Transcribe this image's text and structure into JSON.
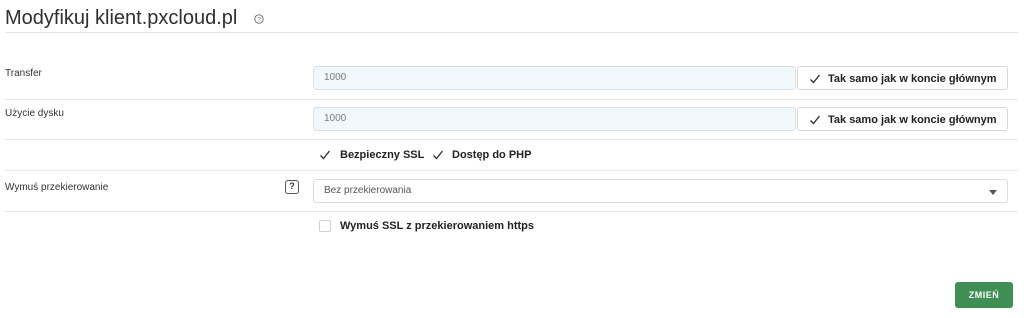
{
  "header": {
    "title": "Modyfikuj klient.pxcloud.pl",
    "help_icon": "question-circle-icon"
  },
  "transfer": {
    "label": "Transfer",
    "value": "1000",
    "same_label": "Tak samo jak w koncie głównym",
    "same_checked": true
  },
  "disk": {
    "label": "Użycie dysku",
    "value": "1000",
    "same_label": "Tak samo jak w koncie głównym",
    "same_checked": true
  },
  "options": [
    {
      "label": "Bezpieczny SSL",
      "checked": true
    },
    {
      "label": "Dostęp do PHP",
      "checked": true
    }
  ],
  "redirect": {
    "label": "Wymuś przekierowanie",
    "help_glyph": "?",
    "selected": "Bez przekierowania"
  },
  "force_ssl": {
    "label": "Wymuś SSL z przekierowaniem https",
    "checked": false
  },
  "submit": {
    "label": "ZMIEŃ",
    "color": "#3f8f55"
  }
}
